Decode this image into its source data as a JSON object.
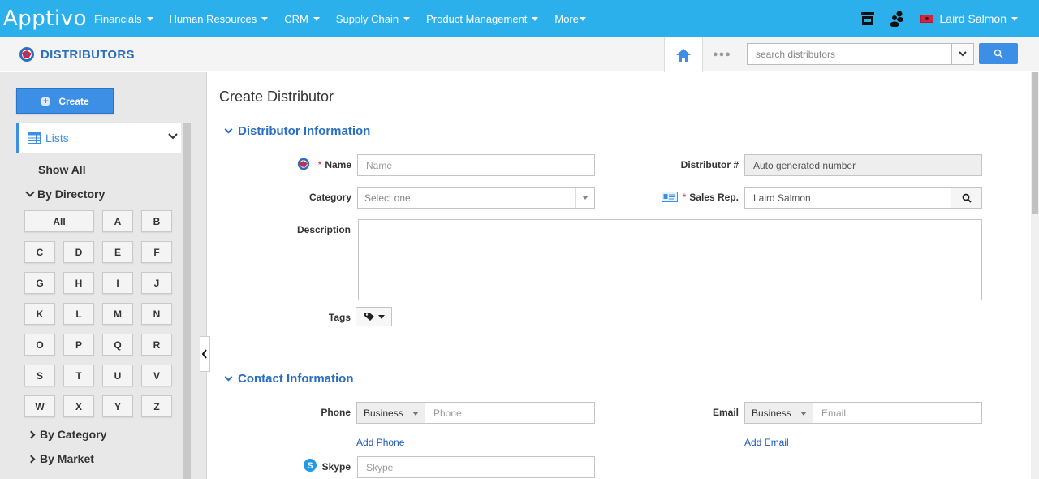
{
  "topnav": {
    "logo": "Apptivo",
    "items": [
      "Financials",
      "Human Resources",
      "CRM",
      "Supply Chain",
      "Product Management",
      "More"
    ],
    "user_name": "Laird Salmon"
  },
  "appbar": {
    "title": "DISTRIBUTORS",
    "search_placeholder": "search distributors",
    "dots": "●●●"
  },
  "sidebar": {
    "create_label": "Create",
    "lists_label": "Lists",
    "show_all": "Show All",
    "by_directory": "By Directory",
    "directory": [
      "All",
      "A",
      "B",
      "C",
      "D",
      "E",
      "F",
      "G",
      "H",
      "I",
      "J",
      "K",
      "L",
      "M",
      "N",
      "O",
      "P",
      "Q",
      "R",
      "S",
      "T",
      "U",
      "V",
      "W",
      "X",
      "Y",
      "Z"
    ],
    "by_category": "By Category",
    "by_market": "By Market"
  },
  "form": {
    "page_title": "Create Distributor",
    "section_distributor": "Distributor Information",
    "section_contact": "Contact Information",
    "name_label": "Name",
    "name_placeholder": "Name",
    "distributor_no_label": "Distributor #",
    "distributor_no_value": "Auto generated number",
    "category_label": "Category",
    "category_placeholder": "Select one",
    "sales_rep_label": "Sales Rep.",
    "sales_rep_value": "Laird Salmon",
    "description_label": "Description",
    "tags_label": "Tags",
    "phone_label": "Phone",
    "phone_type": "Business",
    "phone_placeholder": "Phone",
    "email_label": "Email",
    "email_type": "Business",
    "email_placeholder": "Email",
    "add_phone": "Add Phone",
    "add_email": "Add Email",
    "skype_label": "Skype",
    "skype_placeholder": "Skype"
  },
  "colors": {
    "topbar": "#2bb0ec",
    "accent": "#3c8fe4",
    "section_title": "#2a6fc0",
    "required": "#d9213b"
  }
}
